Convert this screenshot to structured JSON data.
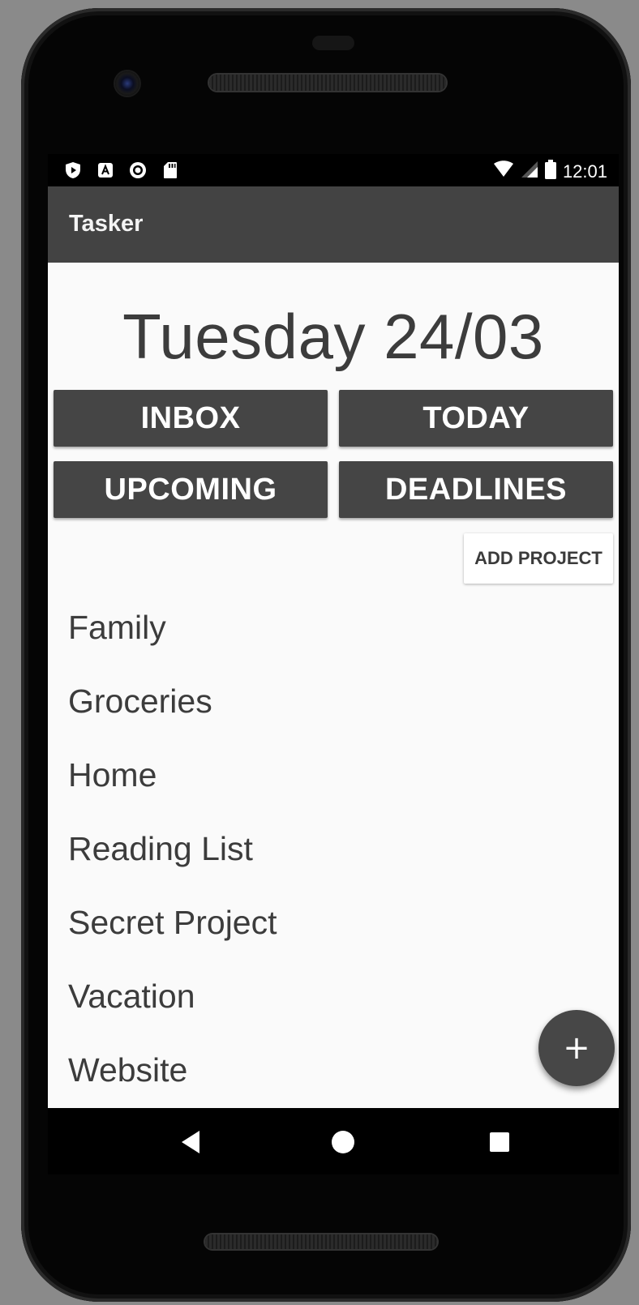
{
  "statusbar": {
    "time": "12:01",
    "left_icons": [
      "play-protect-icon",
      "a-notification-icon",
      "circle-notification-icon",
      "sd-card-icon"
    ],
    "right_icons": [
      "wifi-icon",
      "signal-icon",
      "battery-icon"
    ]
  },
  "appbar": {
    "title": "Tasker"
  },
  "main": {
    "date_heading": "Tuesday 24/03",
    "nav_buttons": {
      "inbox": "INBOX",
      "today": "TODAY",
      "upcoming": "UPCOMING",
      "deadlines": "DEADLINES"
    },
    "add_project_label": "ADD PROJECT",
    "projects": [
      "Family",
      "Groceries",
      "Home",
      "Reading List",
      "Secret Project",
      "Vacation",
      "Website"
    ],
    "fab_label": "+"
  },
  "system_nav": {
    "back_icon": "back-triangle-icon",
    "home_icon": "home-circle-icon",
    "recents_icon": "recents-square-icon"
  },
  "colors": {
    "appbar": "#434343",
    "button": "#454545",
    "background": "#fafafa",
    "text": "#3c3c3c"
  }
}
